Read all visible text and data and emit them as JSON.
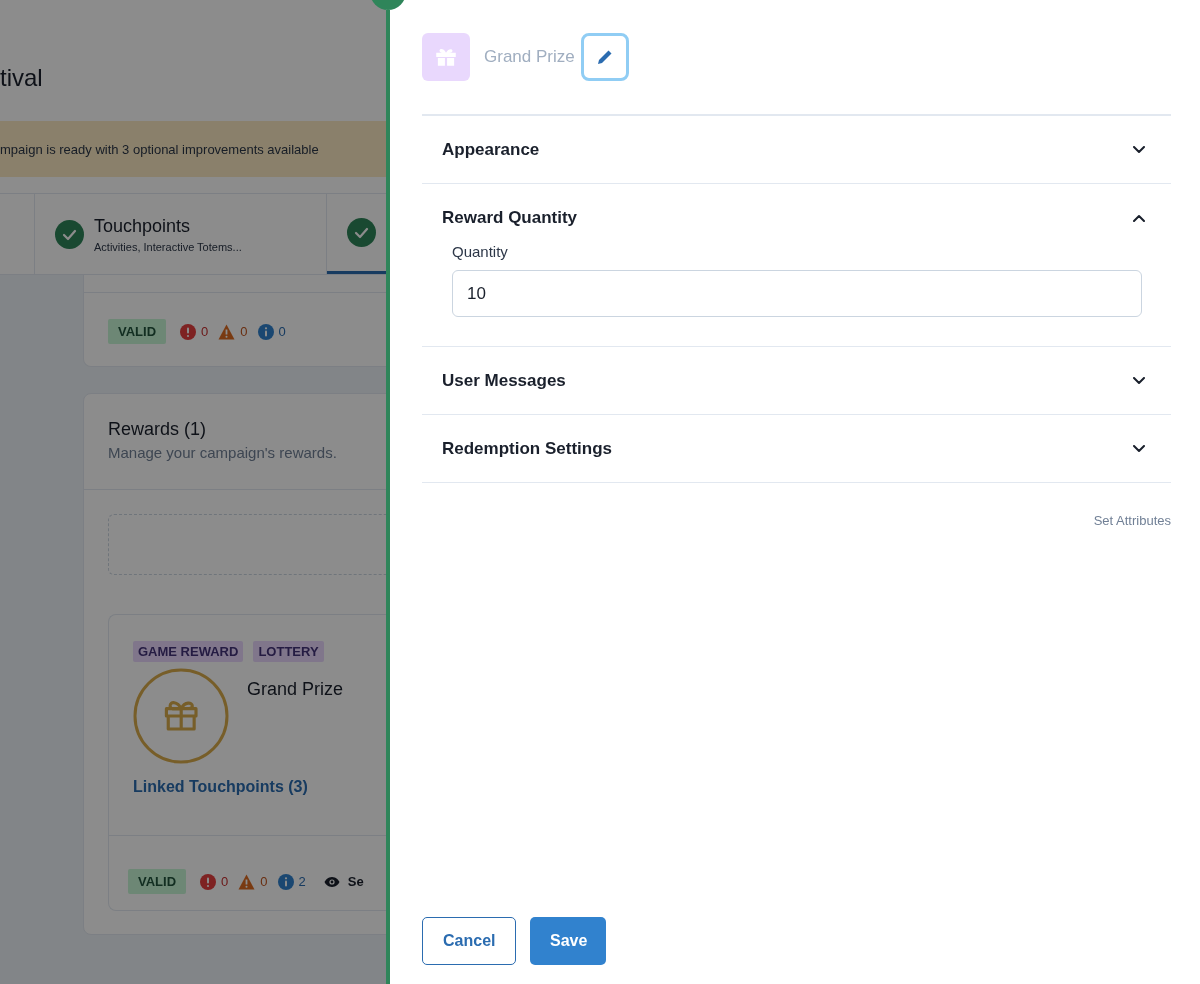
{
  "page": {
    "title_fragment": "tival",
    "banner": "mpaign is ready with 3 optional improvements available",
    "tabs": [
      {
        "title": "Touchpoints",
        "subtitle": "Activities, Interactive Totems...",
        "complete": true,
        "selected": false
      },
      {
        "complete": true,
        "selected": true
      }
    ],
    "validation_card": {
      "status": "VALID",
      "counts": [
        {
          "kind": "error",
          "value": "0"
        },
        {
          "kind": "warning",
          "value": "0"
        },
        {
          "kind": "info",
          "value": "0"
        }
      ]
    },
    "rewards_card": {
      "title": "Rewards (1)",
      "subtitle": "Manage your campaign's rewards.",
      "rewards": [
        {
          "tags": [
            "GAME REWARD",
            "LOTTERY"
          ],
          "name": "Grand Prize",
          "link": "Linked Touchpoints (3)",
          "status": "VALID",
          "counts": [
            {
              "kind": "error",
              "value": "0"
            },
            {
              "kind": "warning",
              "value": "0"
            },
            {
              "kind": "info",
              "value": "2"
            }
          ],
          "action": "Se"
        }
      ]
    }
  },
  "drawer": {
    "name": "Grand Prize",
    "sections": [
      {
        "title": "Appearance",
        "expanded": false
      },
      {
        "title": "Reward Quantity",
        "expanded": true,
        "fields": [
          {
            "label": "Quantity",
            "value": "10"
          }
        ]
      },
      {
        "title": "User Messages",
        "expanded": false
      },
      {
        "title": "Redemption Settings",
        "expanded": false
      }
    ],
    "link": "Set Attributes",
    "buttons": [
      {
        "label": "Cancel",
        "kind": "secondary"
      },
      {
        "label": "Save",
        "kind": "primary"
      }
    ]
  }
}
